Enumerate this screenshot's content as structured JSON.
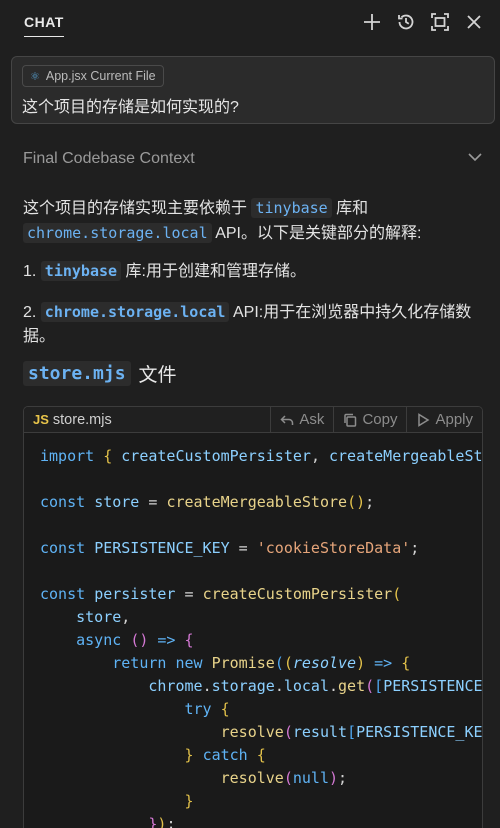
{
  "header": {
    "tab_label": "CHAT",
    "icons": [
      "plus-icon",
      "history-icon",
      "maximize-icon",
      "close-icon"
    ]
  },
  "query": {
    "file_chip_icon": "⚛",
    "file_chip": "App.jsx Current File",
    "text": "这个项目的存储是如何实现的?"
  },
  "context": {
    "title": "Final Codebase Context"
  },
  "answer": {
    "intro_a": "这个项目的存储实现主要依赖于",
    "intro_code1": "tinybase",
    "intro_b": "库和",
    "intro_code2": "chrome.storage.local",
    "intro_c": "API。以下是关键部分的解释:",
    "item1_num": "1.",
    "item1_code": "tinybase",
    "item1_text": "库:用于创建和管理存储。",
    "item2_num": "2.",
    "item2_code": "chrome.storage.local",
    "item2_text": "API:用于在浏览器中持久化存储数据。",
    "heading_code": "store.mjs",
    "heading_text": "文件"
  },
  "code_block": {
    "lang_badge": "JS",
    "filename": "store.mjs",
    "actions": {
      "ask": "Ask",
      "copy": "Copy",
      "apply": "Apply"
    }
  },
  "colors": {
    "background": "#1f1f1f",
    "accent": "#6cb2f2",
    "keyword": "#5fb3f5",
    "function": "#e8d38a",
    "string": "#e6a57a"
  }
}
